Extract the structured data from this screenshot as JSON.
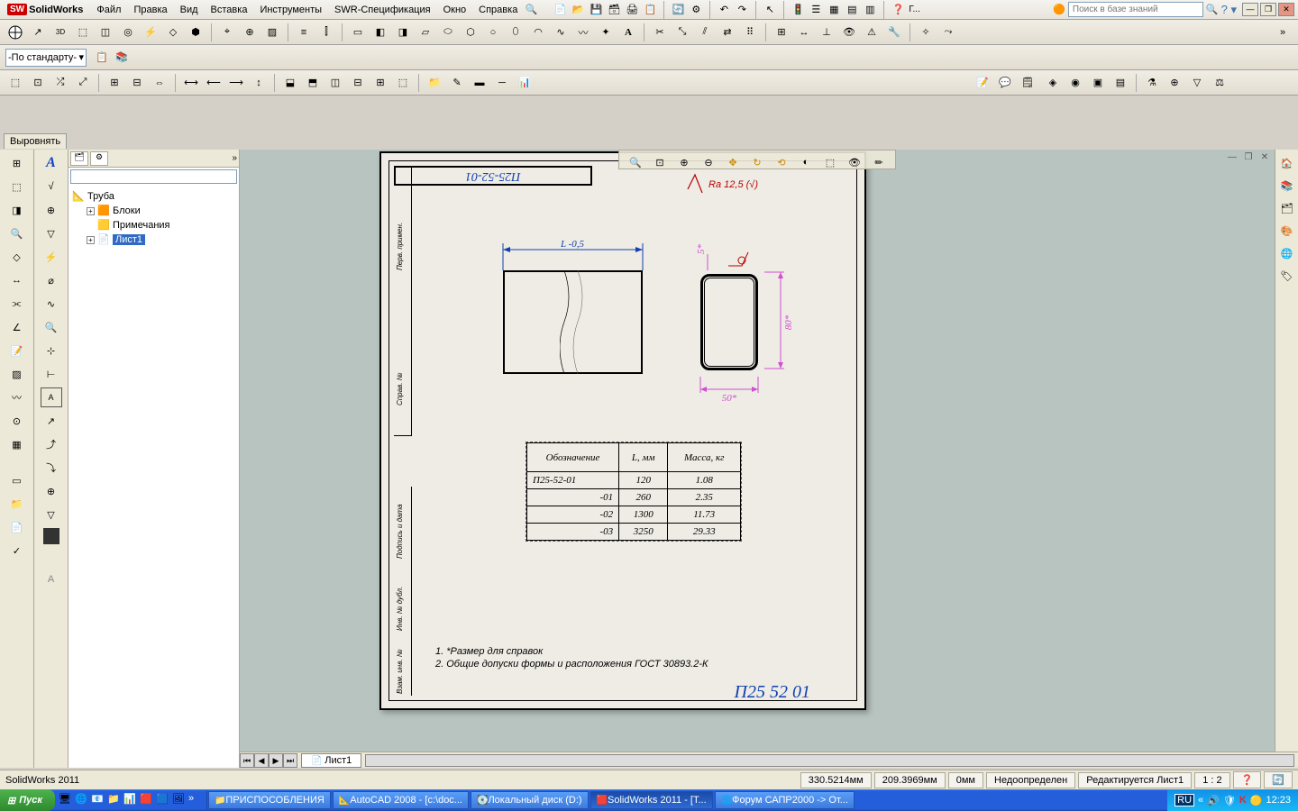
{
  "app": {
    "title": "SolidWorks",
    "version_status": "SolidWorks 2011"
  },
  "menu": [
    "Файл",
    "Правка",
    "Вид",
    "Вставка",
    "Инструменты",
    "SWR-Спецификация",
    "Окно",
    "Справка"
  ],
  "search": {
    "placeholder": "Поиск в базе знаний"
  },
  "help_letter": "Г...",
  "standard_combo": "-По стандарту-",
  "panel_tab": "Выровнять",
  "tree": {
    "root": "Труба",
    "blocks": "Блоки",
    "annotations": "Примечания",
    "sheet": "Лист1"
  },
  "drawing": {
    "part_no_top": "П25-52-01",
    "surface": "Ra 12,5 (√)",
    "dim_L": "L -0,5",
    "dim_5": "5*",
    "dim_50": "50*",
    "dim_80": "80*",
    "side_text_1": "Перв. примен.",
    "side_text_2": "Справ. №",
    "side_text_3": "Подпись и дата",
    "side_text_4": "Инв. № дубл.",
    "side_text_5": "Взам. инв. №",
    "big_title": "П25 52 01",
    "table": {
      "headers": [
        "Обозначение",
        "L, мм",
        "Масса, кг"
      ],
      "rows": [
        [
          "П25-52-01",
          "120",
          "1.08"
        ],
        [
          "-01",
          "260",
          "2.35"
        ],
        [
          "-02",
          "1300",
          "11.73"
        ],
        [
          "-03",
          "3250",
          "29.33"
        ]
      ]
    },
    "notes": [
      "1.    *Размер для справок",
      "2.    Общие допуски формы и расположения ГОСТ 30893.2-К"
    ]
  },
  "sheet_tab": "Лист1",
  "status": {
    "x": "330.5214мм",
    "y": "209.3969мм",
    "z": "0мм",
    "state": "Недоопределен",
    "edit": "Редактируется Лист1",
    "scale": "1 : 2"
  },
  "taskbar": {
    "start": "Пуск",
    "items": [
      "ПРИСПОСОБЛЕНИЯ",
      "AutoCAD 2008 - [c:\\doc...",
      "Локальный диск (D:)",
      "SolidWorks 2011 - [Т...",
      "Форум САПР2000 -> От..."
    ],
    "lang": "RU",
    "clock": "12:23"
  }
}
